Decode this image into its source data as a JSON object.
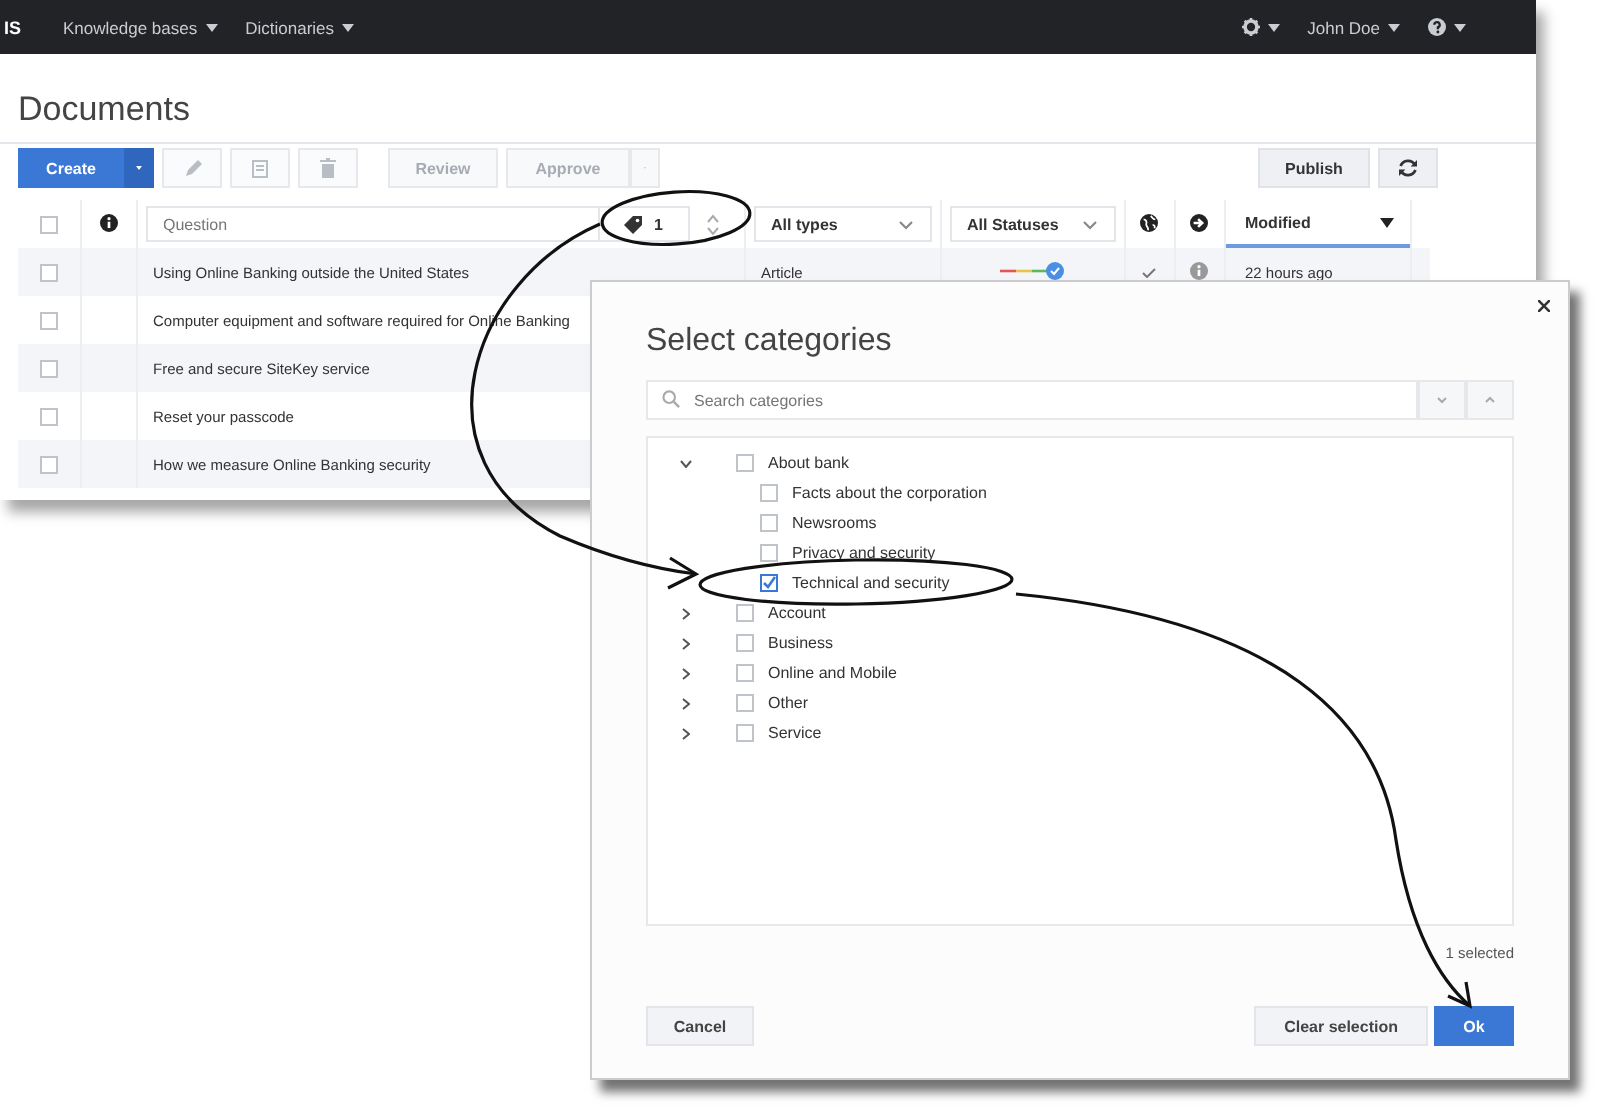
{
  "topbar": {
    "brand": "IS",
    "nav": [
      {
        "label": "Knowledge bases"
      },
      {
        "label": "Dictionaries"
      }
    ],
    "user": "John Doe"
  },
  "page_title": "Documents",
  "toolbar": {
    "create": {
      "label": "Create"
    },
    "icon_buttons": [
      {
        "kind": "edit",
        "disabled": true
      },
      {
        "kind": "document",
        "disabled": true
      },
      {
        "kind": "delete",
        "disabled": true
      }
    ],
    "review": {
      "label": "Review",
      "disabled": true
    },
    "approve": {
      "label": "Approve",
      "disabled": true
    },
    "publish": {
      "label": "Publish",
      "disabled": false
    }
  },
  "table": {
    "select_all_checked": false,
    "question_placeholder": "Question",
    "category_count": "1",
    "type_filter": "All types",
    "status_filter": "All Statuses",
    "modified": "Modified",
    "rows": [
      {
        "question": "Using Online Banking outside the United States",
        "checked": false,
        "type": "Article",
        "modified": "22 hours ago"
      },
      {
        "question": "Computer equipment and software required for Online Banking",
        "checked": false
      },
      {
        "question": "Free and secure SiteKey service",
        "checked": false
      },
      {
        "question": "Reset your passcode",
        "checked": false
      },
      {
        "question": "How we measure Online Banking security",
        "checked": false
      }
    ]
  },
  "dialog": {
    "title": "Select categories",
    "search_placeholder": "Search categories",
    "categories": [
      {
        "label": "About bank",
        "expanded": true,
        "checked": false,
        "children": [
          {
            "label": "Facts about the corporation",
            "checked": false
          },
          {
            "label": "Newsrooms",
            "checked": false
          },
          {
            "label": "Privacy and security",
            "checked": false
          },
          {
            "label": "Technical and security",
            "checked": true
          }
        ]
      },
      {
        "label": "Account",
        "expanded": false,
        "checked": false
      },
      {
        "label": "Business",
        "expanded": false,
        "checked": false
      },
      {
        "label": "Online and Mobile",
        "expanded": false,
        "checked": false
      },
      {
        "label": "Other",
        "expanded": false,
        "checked": false
      },
      {
        "label": "Service",
        "expanded": false,
        "checked": false
      }
    ],
    "selection_count": "1 selected",
    "buttons": [
      {
        "kind": "secondary",
        "label": "Cancel"
      },
      {
        "kind": "secondary",
        "label": "Clear selection"
      },
      {
        "kind": "primary",
        "label": "Ok"
      }
    ]
  }
}
